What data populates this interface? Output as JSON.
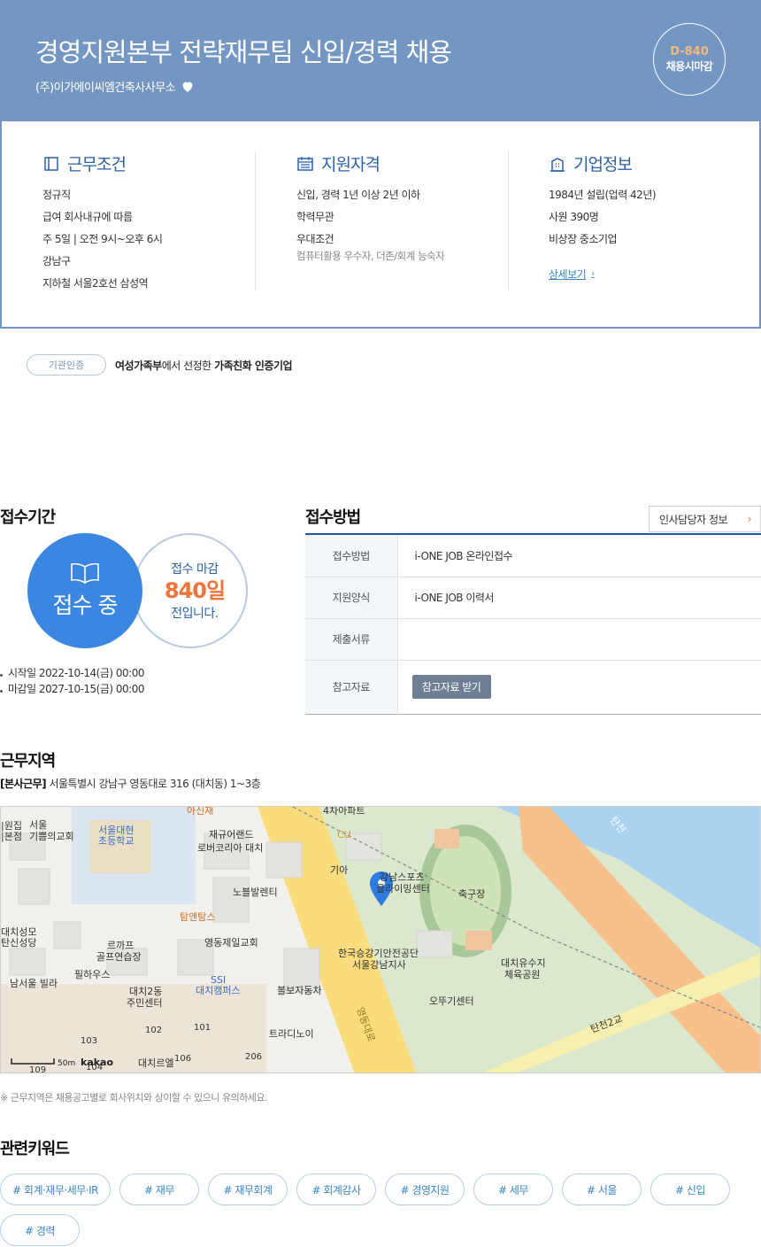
{
  "header": {
    "title": "경영지원본부 전략재무팀 신입/경력 채용",
    "company": "(주)이가에이씨엠건축사사무소",
    "dday": "D-840",
    "dday_label": "채용시마감"
  },
  "summary": {
    "work": {
      "heading": "근무조건",
      "lines": [
        "정규직",
        "급여 회사내규에 따름",
        "주 5일 | 오전 9시~오후 6시",
        "강남구",
        "지하철 서울2호선 삼성역"
      ]
    },
    "qualification": {
      "heading": "지원자격",
      "lines": [
        "신입, 경력 1년 이상 2년 이하",
        "학력무관",
        "우대조건"
      ],
      "sub": "컴퓨터활용 우수자, 더존/회계 능숙자"
    },
    "company": {
      "heading": "기업정보",
      "lines": [
        "1984년 설립(업력 42년)",
        "사원 390명",
        "비상장 중소기업"
      ],
      "detail_link": "상세보기"
    }
  },
  "certification": {
    "pill": "기관인증",
    "org": "여성가족부",
    "mid": "에서 선정한 ",
    "name": "가족친화 인증기업"
  },
  "period": {
    "title": "접수기간",
    "status": "접수 중",
    "deadline_prefix": "접수 마감",
    "days": "840일",
    "deadline_suffix": "전입니다.",
    "start": "시작일 2022-10-14(금) 00:00",
    "end": "마감일 2027-10-15(금) 00:00"
  },
  "method": {
    "title": "접수방법",
    "hr_button": "인사담당자 정보",
    "rows": [
      {
        "label": "접수방법",
        "value": "i-ONE JOB 온라인접수"
      },
      {
        "label": "지원양식",
        "value": "i-ONE JOB 이력서"
      },
      {
        "label": "제출서류",
        "value": ""
      },
      {
        "label": "참고자료",
        "button": "참고자료 받기"
      }
    ]
  },
  "location": {
    "title": "근무지역",
    "tag": "[본사근무]",
    "address": "서울특별시 강남구 영동대로 316 (대치동) 1~3층",
    "note": "※ 근무지역은 채용공고별로 회사위치와 상이할 수 있으니 유의하세요.",
    "map_labels": {
      "school": "서울대현\n초등학교",
      "church1": "서울\n기쁨의교회",
      "church2": "대치성모\n탄신성당",
      "church3": "영동제일교회",
      "bldg1": "재규어랜드\n로버코리아 대치",
      "bldg2": "노블발렌티",
      "cafe": "탐앤탐스",
      "golf": "르까프\n골프연습장",
      "center": "대치2동\n주민센터",
      "ssi": "SSI\n대치캠퍼스",
      "volvo": "볼보자동차",
      "trading": "트라디노이",
      "cu": "CU",
      "kia": "기아",
      "sports": "강남스포츠\n클라이밍센터",
      "stadium": "축구장",
      "target": "한국승강기안전공단\n서울강남지사",
      "ottogi": "오뚜기센터",
      "park": "대치유수지\n체육공원",
      "bridge": "탄천2교",
      "villa": "남서울 빌라",
      "pilha": "필하우스",
      "road": "영동대로",
      "top1": "4차아파트",
      "top2": "아신재",
      "tancheon": "탄천",
      "left1": "|원집\n|본점",
      "scale": "50m",
      "brand": "kakao",
      "num101": "101",
      "num102": "102",
      "num103": "103",
      "num104": "104",
      "num106": "106",
      "num109": "109",
      "num206": "206",
      "daechi": "대치르엘\n아파트"
    }
  },
  "keywords": {
    "title": "관련키워드",
    "items": [
      "# 회계·재무·세무·IR",
      "# 재무",
      "# 재무회계",
      "# 회계감사",
      "# 경영지원",
      "# 세무",
      "# 서울",
      "# 신입",
      "# 경력"
    ]
  },
  "colors": {
    "hero": "#7396c3",
    "accent_blue": "#3a86e0",
    "accent_orange": "#f0743a",
    "navy": "#1f5a9c"
  }
}
